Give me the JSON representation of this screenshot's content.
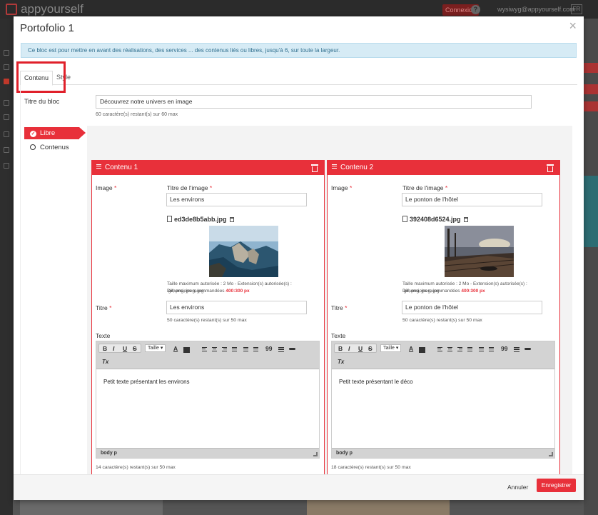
{
  "background": {
    "logo": "appyourself",
    "connect_label": "Connexion",
    "help_label": "?",
    "user_email": "wysiwyg@appyourself.com",
    "lang": "FR"
  },
  "modal": {
    "title": "Portofolio 1",
    "close_label": "×",
    "info": "Ce bloc est pour mettre en avant des réalisations, des services ... des contenus liés ou libres, jusqu'à 6, sur toute la largeur.",
    "tabs": [
      {
        "label": "Contenu",
        "active": true
      },
      {
        "label": "Style",
        "active": false
      }
    ],
    "block_title": {
      "label": "Titre du bloc",
      "value": "Découvrez notre univers en image",
      "hint": "60 caractère(s) restant(s) sur 60 max"
    },
    "nav": [
      {
        "label": "Libre",
        "selected": true
      },
      {
        "label": "Contenus",
        "selected": false
      }
    ],
    "cards": [
      {
        "header": "Contenu 1",
        "image_label": "Image",
        "image_title_label": "Titre de l'image",
        "image_title_value": "Les environs",
        "filename": "ed3de8b5abb.jpg",
        "size_hint": "Taille maximum autorisée : 2 Mo - Extension(s) autorisée(s) : .gif,.png,.jpeg,.jpg -",
        "dims_hint": "Dimensions recommandées",
        "dims_value": "400:300 px",
        "titre_label": "Titre",
        "titre_value": "Les environs",
        "titre_counter": "50 caractère(s) restant(s) sur 50 max",
        "texte_label": "Texte",
        "editor_text": "Petit texte présentant les environs",
        "editor_path": "body  p",
        "texte_counter": "14 caractère(s) restant(s) sur 50 max"
      },
      {
        "header": "Contenu 2",
        "image_label": "Image",
        "image_title_label": "Titre de l'image",
        "image_title_value": "Le ponton de l'hôtel",
        "filename": "392408d6524.jpg",
        "size_hint": "Taille maximum autorisée : 2 Mo - Extension(s) autorisée(s) : .gif,.png,.jpeg,.jpg -",
        "dims_hint": "Dimensions recommandées",
        "dims_value": "400:300 px",
        "titre_label": "Titre",
        "titre_value": "Le ponton de l'hôtel",
        "titre_counter": "50 caractère(s) restant(s) sur 50 max",
        "texte_label": "Texte",
        "editor_text": "Petit texte présentant le déco",
        "editor_path": "body  p",
        "texte_counter": "18 caractère(s) restant(s) sur 50 max"
      }
    ],
    "toolbar": {
      "bold": "B",
      "italic": "I",
      "underline": "U",
      "strike": "S",
      "format": "Taille",
      "text_color": "A",
      "bg_color": "A",
      "quote": "99",
      "clear": "Tx"
    },
    "footer": {
      "cancel": "Annuler",
      "save": "Enregistrer"
    }
  },
  "colors": {
    "accent": "#e8303a",
    "info_bg": "#d6ebf5",
    "info_text": "#31708f"
  }
}
